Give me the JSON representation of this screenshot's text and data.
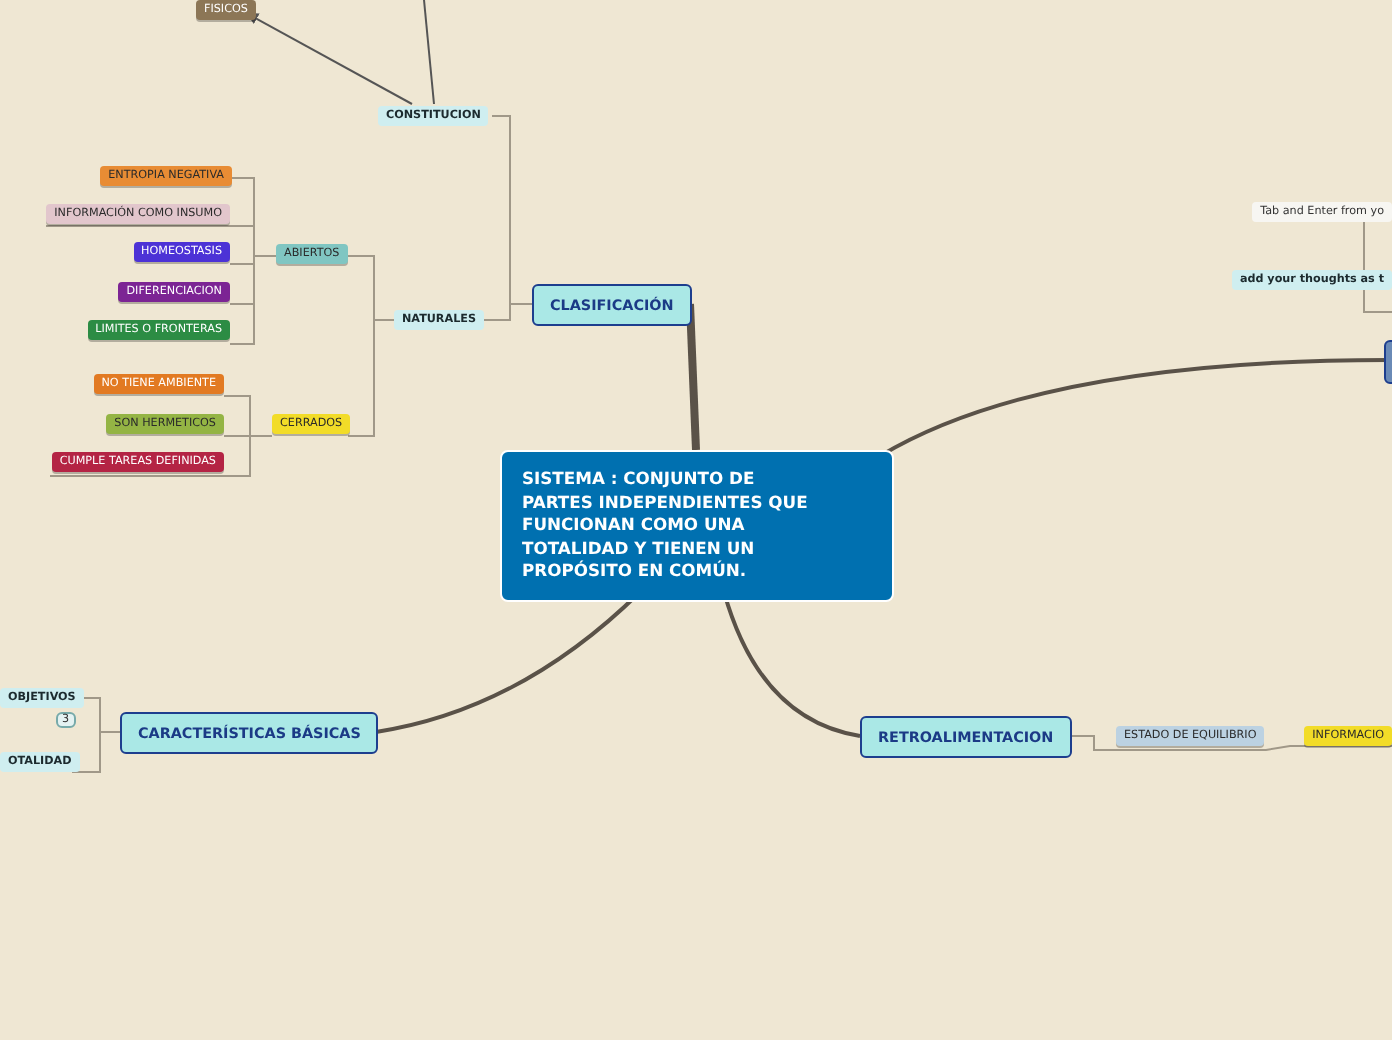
{
  "nodes": [
    {
      "kind": "tag",
      "text": "FISICOS",
      "color": "#8c7656"
    },
    {
      "kind": "subtopic",
      "text": "CONSTITUCION"
    },
    {
      "kind": "topic",
      "text": "CLASIFICACIÓN"
    },
    {
      "kind": "subtopic",
      "text": "NATURALES"
    },
    {
      "kind": "tag",
      "text": "ABIERTOS",
      "color": "#80c6c2"
    },
    {
      "kind": "tag",
      "text": "CERRADOS",
      "color": "#f2dc28"
    },
    {
      "kind": "tag",
      "text": "ENTROPIA NEGATIVA",
      "color": "#e88c34"
    },
    {
      "kind": "tag",
      "text": "INFORMACIÓN COMO INSUMO",
      "color": "#e2c6cc"
    },
    {
      "kind": "tag",
      "text": "HOMEOSTASIS",
      "color": "#4c32d6"
    },
    {
      "kind": "tag",
      "text": "DIFERENCIACION",
      "color": "#7c2494"
    },
    {
      "kind": "tag",
      "text": "LIMITES O FRONTERAS",
      "color": "#2c8c44"
    },
    {
      "kind": "tag",
      "text": "NO TIENE AMBIENTE",
      "color": "#e27a22"
    },
    {
      "kind": "tag",
      "text": "SON HERMETICOS",
      "color": "#94b444"
    },
    {
      "kind": "tag",
      "text": "CUMPLE TAREAS DEFINIDAS",
      "color": "#b42444"
    },
    {
      "kind": "note",
      "text": "Tab and Enter from yo"
    },
    {
      "kind": "subtopic",
      "text": "add your thoughts as t"
    },
    {
      "kind": "central",
      "text": "SISTEMA : CONJUNTO DE PARTES INDEPENDIENTES QUE FUNCIONAN COMO UNA TOTALIDAD Y TIENEN UN PROPÓSITO EN COMÚN."
    },
    {
      "kind": "topic",
      "text": "CARACTERÍSTICAS BÁSICAS"
    },
    {
      "kind": "subtopic",
      "text": "OBJETIVOS"
    },
    {
      "kind": "badge",
      "text": "3"
    },
    {
      "kind": "subtopic",
      "text": "OTALIDAD"
    },
    {
      "kind": "topic",
      "text": "RETROALIMENTACION"
    },
    {
      "kind": "tag",
      "text": "ESTADO DE EQUILIBRIO",
      "color": "#bcd2e2"
    },
    {
      "kind": "tag",
      "text": "INFORMACIO",
      "color": "#f2dc28"
    }
  ]
}
